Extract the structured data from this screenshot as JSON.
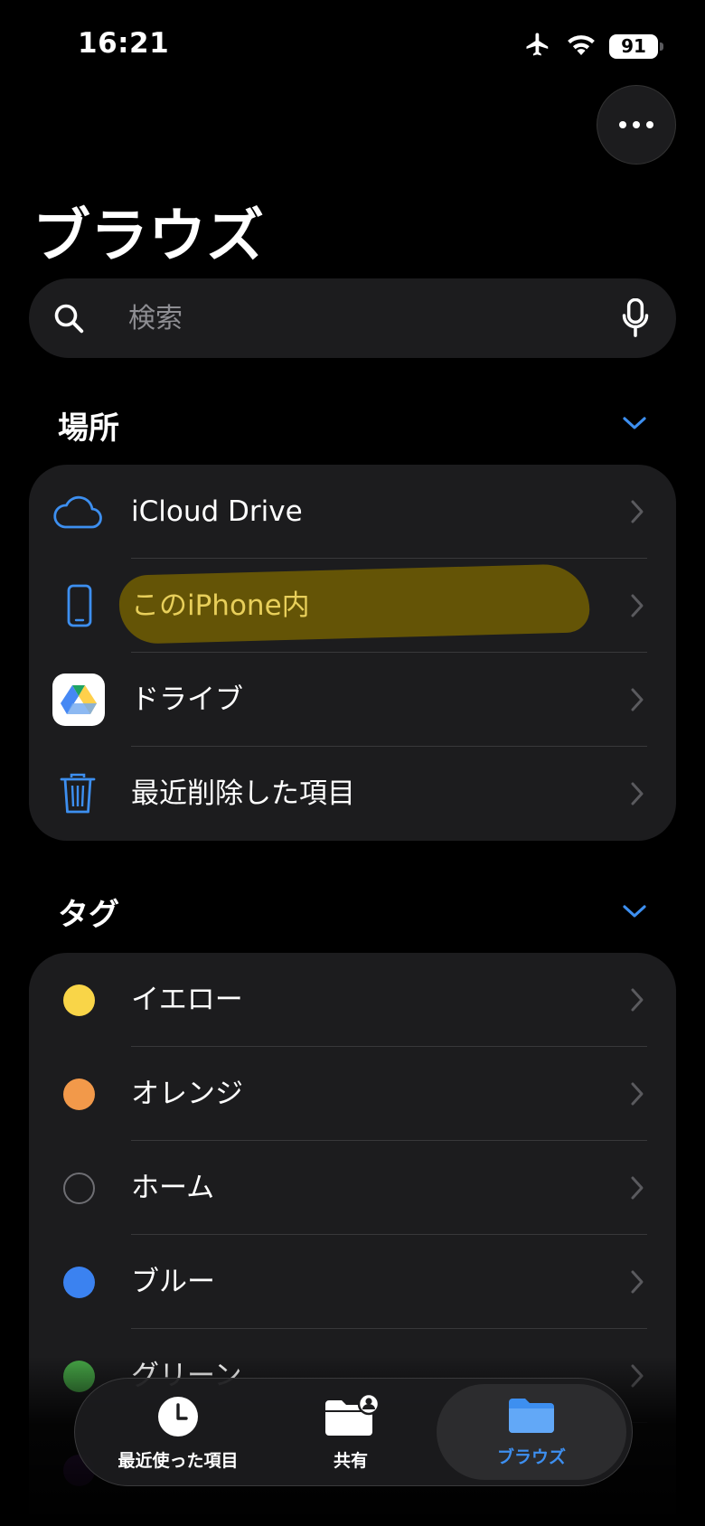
{
  "status_bar": {
    "time": "16:21",
    "battery": "91"
  },
  "header": {
    "title": "ブラウズ",
    "more_icon": "ellipsis-icon"
  },
  "search": {
    "placeholder": "検索"
  },
  "locations": {
    "header": "場所",
    "items": [
      {
        "label": "iCloud Drive",
        "icon": "icloud-icon"
      },
      {
        "label": "このiPhone内",
        "icon": "iphone-icon",
        "highlighted": true
      },
      {
        "label": "ドライブ",
        "icon": "google-drive-icon"
      },
      {
        "label": "最近削除した項目",
        "icon": "trash-icon"
      }
    ]
  },
  "tags": {
    "header": "タグ",
    "items": [
      {
        "label": "イエロー",
        "color": "#f9d548"
      },
      {
        "label": "オレンジ",
        "color": "#f2994a"
      },
      {
        "label": "ホーム",
        "color": "outline"
      },
      {
        "label": "ブルー",
        "color": "#3b82f0"
      },
      {
        "label": "グリーン",
        "color": "#46a546"
      }
    ]
  },
  "tab_bar": {
    "tabs": [
      {
        "label": "最近使った項目",
        "icon": "clock-icon"
      },
      {
        "label": "共有",
        "icon": "shared-folder-icon"
      },
      {
        "label": "ブラウズ",
        "icon": "folder-icon",
        "active": true
      }
    ]
  },
  "colors": {
    "accent": "#3d8ff0",
    "background": "#000000",
    "group_background": "#1c1c1e",
    "highlight": "#7a6400"
  }
}
